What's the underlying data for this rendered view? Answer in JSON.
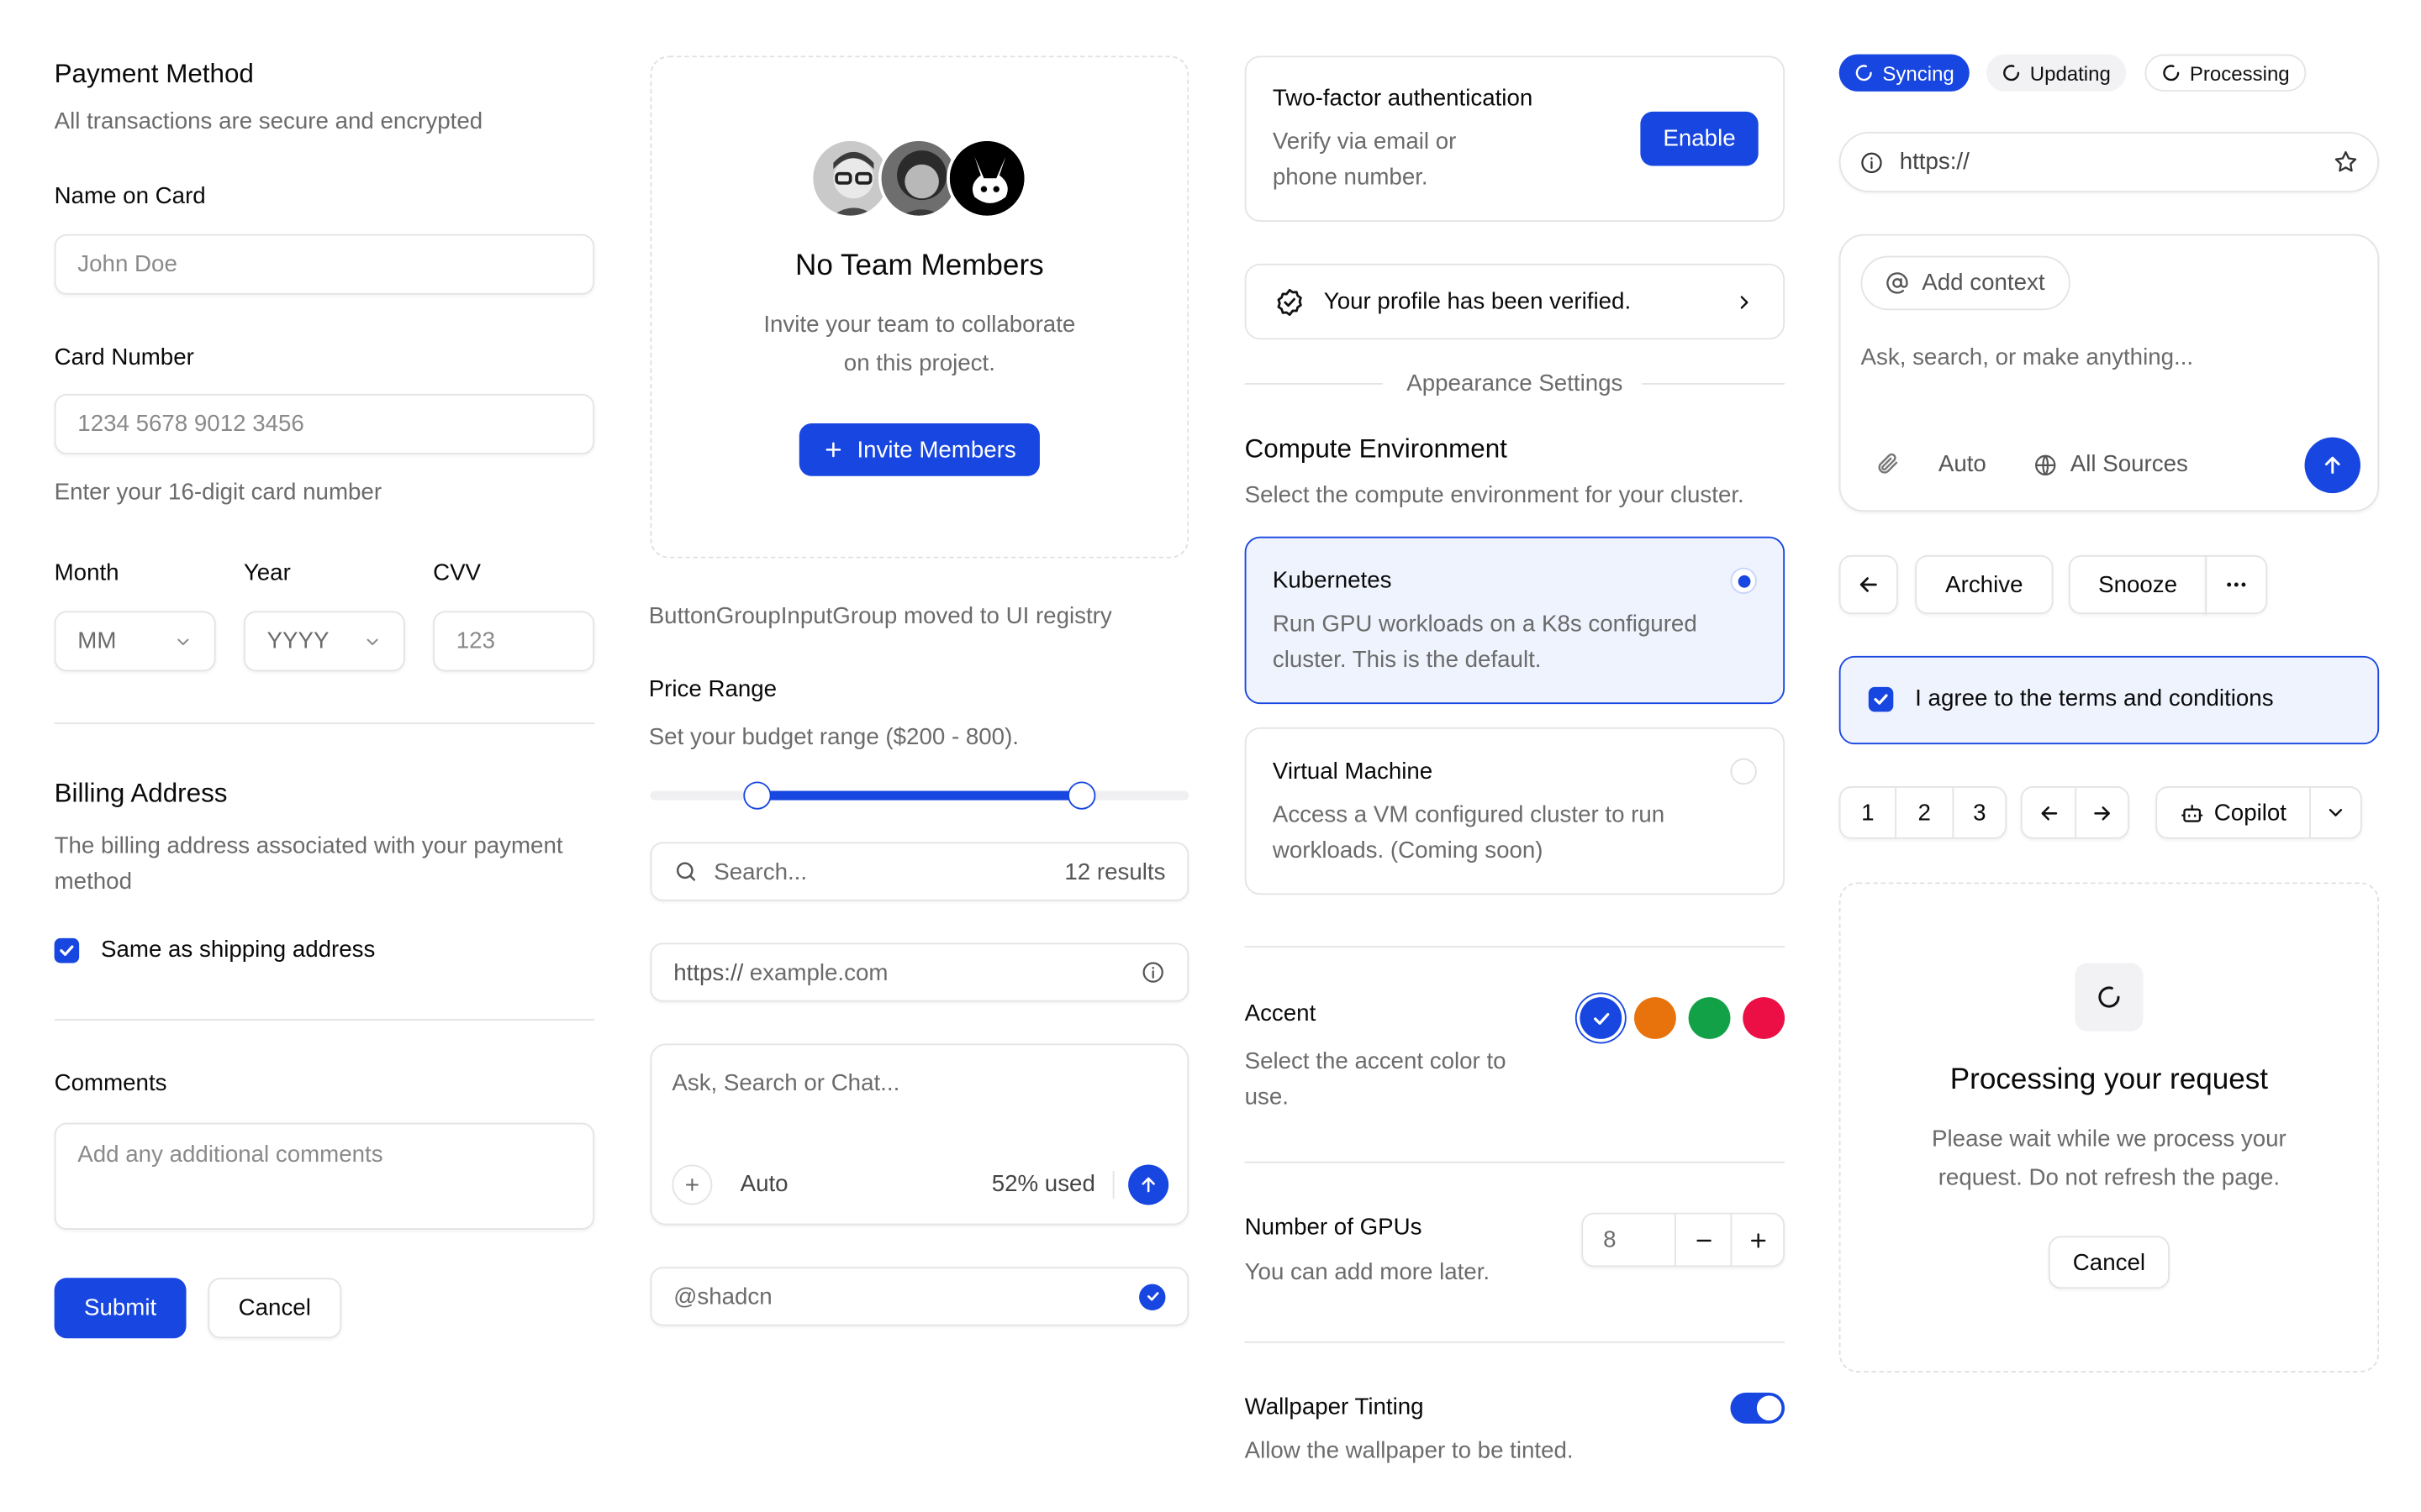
{
  "payment": {
    "title": "Payment Method",
    "subtitle": "All transactions are secure and encrypted",
    "name_label": "Name on Card",
    "name_placeholder": "John Doe",
    "card_label": "Card Number",
    "card_placeholder": "1234 5678 9012 3456",
    "card_help": "Enter your 16-digit card number",
    "month_label": "Month",
    "month_value": "MM",
    "year_label": "Year",
    "year_value": "YYYY",
    "cvv_label": "CVV",
    "cvv_placeholder": "123",
    "billing_title": "Billing Address",
    "billing_desc": "The billing address associated with your payment method",
    "same_address_label": "Same as shipping address",
    "same_address_checked": true,
    "comments_label": "Comments",
    "comments_placeholder": "Add any additional comments",
    "submit_label": "Submit",
    "cancel_label": "Cancel"
  },
  "team": {
    "title": "No Team Members",
    "desc": "Invite your team to collaborate on this project.",
    "invite_label": "Invite Members",
    "avatars": [
      "avatar-glasses",
      "avatar-curly",
      "avatar-bunny-logo"
    ]
  },
  "misc": {
    "notice": "ButtonGroupInputGroup moved to UI registry",
    "price_title": "Price Range",
    "price_desc": "Set your budget range ($200 - 800).",
    "price_min": 200,
    "price_max": 800,
    "search_placeholder": "Search...",
    "search_results": "12 results",
    "url_prefix": "https://",
    "url_placeholder": "example.com",
    "chat_placeholder": "Ask, Search or Chat...",
    "chat_mode": "Auto",
    "chat_usage": "52% used",
    "username_placeholder": "@shadcn"
  },
  "settings": {
    "twofa_title": "Two-factor authentication",
    "twofa_desc": "Verify via email or phone number.",
    "twofa_button": "Enable",
    "verified_text": "Your profile has been verified.",
    "appearance_label": "Appearance Settings",
    "compute_title": "Compute Environment",
    "compute_desc": "Select the compute environment for your cluster.",
    "options": [
      {
        "title": "Kubernetes",
        "desc": "Run GPU workloads on a K8s configured cluster. This is the default.",
        "selected": true
      },
      {
        "title": "Virtual Machine",
        "desc": "Access a VM configured cluster to run workloads. (Coming soon)",
        "selected": false
      }
    ],
    "accent_title": "Accent",
    "accent_desc": "Select the accent color to use.",
    "accent_colors": [
      "#1746e0",
      "#e8730c",
      "#12a146",
      "#ec0f45"
    ],
    "accent_selected": "#1746e0",
    "gpus_title": "Number of GPUs",
    "gpus_desc": "You can add more later.",
    "gpus_value": "8",
    "wallpaper_title": "Wallpaper Tinting",
    "wallpaper_desc": "Allow the wallpaper to be tinted.",
    "wallpaper_on": true
  },
  "right": {
    "badges": [
      "Syncing",
      "Updating",
      "Processing"
    ],
    "url_value": "https://",
    "add_context_label": "Add context",
    "prompt_placeholder": "Ask, search, or make anything...",
    "prompt_mode": "Auto",
    "sources_label": "All Sources",
    "archive_label": "Archive",
    "snooze_label": "Snooze",
    "terms_label": "I agree to the terms and conditions",
    "terms_checked": true,
    "pages": [
      "1",
      "2",
      "3"
    ],
    "copilot_label": "Copilot",
    "processing_title": "Processing your request",
    "processing_desc": "Please wait while we process your request. Do not refresh the page.",
    "processing_cancel": "Cancel"
  },
  "colors": {
    "primary": "#1746e0",
    "border": "#e4e4e7",
    "muted_text": "#6b6b6b"
  }
}
